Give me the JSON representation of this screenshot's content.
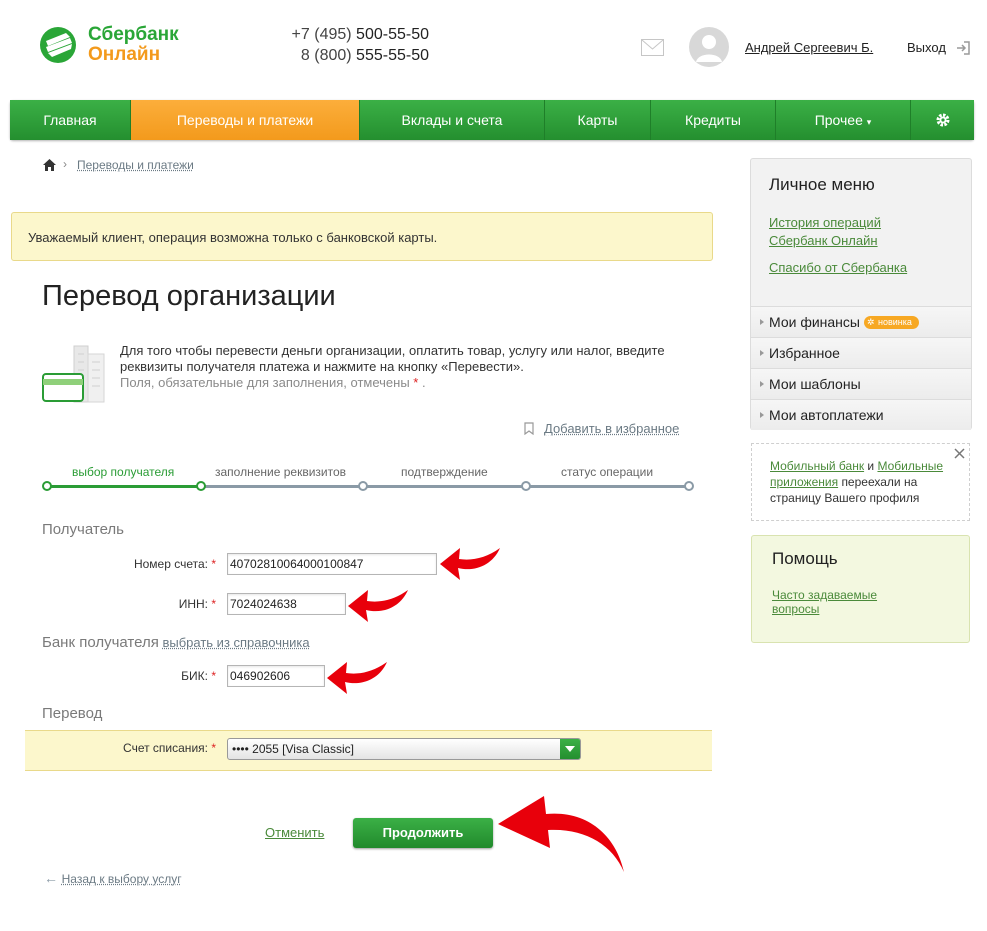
{
  "header": {
    "logo_line1": "Сбербанк",
    "logo_line2": "Онлайн",
    "phone1_prefix": "+7 (495)",
    "phone1_number": "500-55-50",
    "phone2_prefix": "8 (800)",
    "phone2_number": "555-55-50",
    "user_name": "Андрей Сергеевич Б.",
    "logout_label": "Выход"
  },
  "nav": {
    "items": [
      {
        "label": "Главная"
      },
      {
        "label": "Переводы и платежи"
      },
      {
        "label": "Вклады и счета"
      },
      {
        "label": "Карты"
      },
      {
        "label": "Кредиты"
      },
      {
        "label": "Прочее"
      }
    ],
    "other_caret": "▾"
  },
  "breadcrumb": {
    "item": "Переводы и платежи"
  },
  "notice": "Уважаемый клиент, операция возможна только с банковской карты.",
  "page": {
    "title": "Перевод организации",
    "intro": "Для того чтобы перевести деньги организации, оплатить товар, услугу или налог, введите реквизиты получателя платежа и нажмите на кнопку «Перевести».",
    "hint_prefix": "Поля, обязательные для заполнения, отмечены",
    "hint_star": "*",
    "hint_suffix": ".",
    "add_favorite": "Добавить в избранное"
  },
  "steps": [
    {
      "label": "выбор получателя"
    },
    {
      "label": "заполнение реквизитов"
    },
    {
      "label": "подтверждение"
    },
    {
      "label": "статус операции"
    }
  ],
  "form": {
    "recipient_section": "Получатель",
    "account_label": "Номер счета:",
    "account_value": "40702810064000100847",
    "inn_label": "ИНН:",
    "inn_value": "7024024638",
    "bank_section": "Банк получателя",
    "bank_choose": "выбрать из справочника",
    "bik_label": "БИК:",
    "bik_value": "046902606",
    "transfer_section": "Перевод",
    "debit_label": "Счет списания:",
    "debit_value": "•••• 2055 [Visa Classic]",
    "required_star": "*"
  },
  "actions": {
    "cancel": "Отменить",
    "continue": "Продолжить",
    "back": "Назад к выбору услуг"
  },
  "sidebar": {
    "personal_menu_title": "Личное меню",
    "history_link_line1": "История операций",
    "history_link_line2": "Сбербанк Онлайн",
    "thanks_link": "Спасибо от Сбербанка",
    "menu_items": [
      {
        "label": "Мои финансы",
        "badge": "новинка"
      },
      {
        "label": "Избранное"
      },
      {
        "label": "Мои шаблоны"
      },
      {
        "label": "Мои автоплатежи"
      }
    ],
    "mobile_notice": {
      "link1": "Мобильный банк",
      "and": "и",
      "link2_line1": "Мобильные",
      "link2_line2": "приложения",
      "rest_line2": "переехали на",
      "rest_line3": "страницу Вашего профиля"
    },
    "help_title": "Помощь",
    "faq_line1": "Часто задаваемые",
    "faq_line2": "вопросы"
  },
  "colors": {
    "brand_green": "#2a9c35",
    "active_tab_orange": "#f39a1c",
    "arrow_red": "#e8000b"
  }
}
